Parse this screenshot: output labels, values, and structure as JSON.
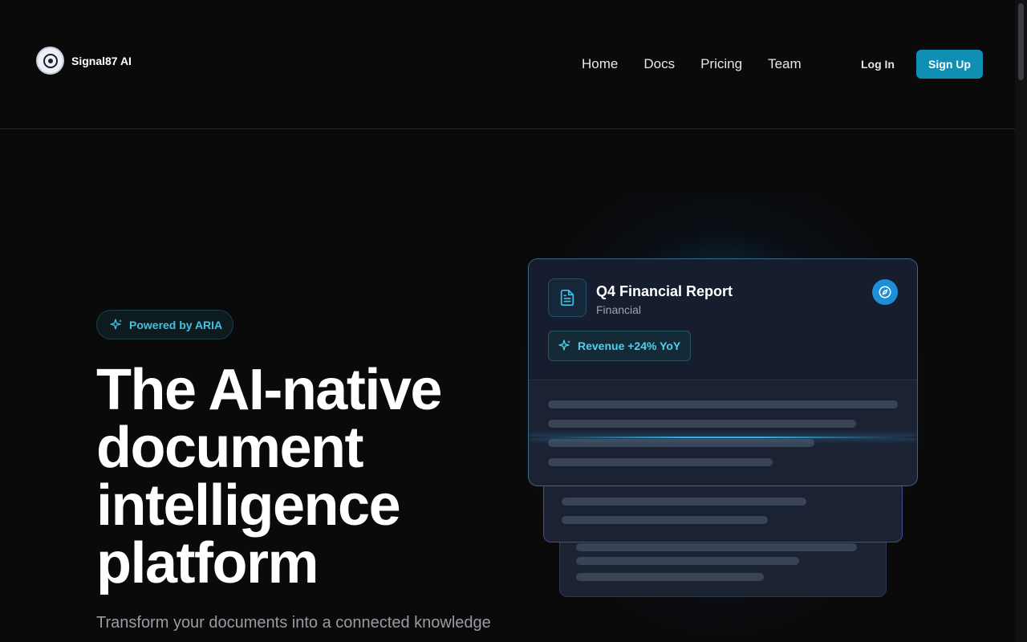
{
  "brand": {
    "name": "Signal87 AI"
  },
  "nav": {
    "links": [
      "Home",
      "Docs",
      "Pricing",
      "Team"
    ],
    "login_label": "Log In",
    "signup_label": "Sign Up"
  },
  "hero": {
    "badge": "Powered by ARIA",
    "headline": "The AI-native document intelligence platform",
    "subtext": "Transform your documents into a connected knowledge"
  },
  "card": {
    "title": "Q4 Financial Report",
    "category": "Financial",
    "metric": "Revenue +24% YoY"
  },
  "colors": {
    "accent": "#0e8fb3",
    "badge_text": "#3fc3e6",
    "background": "#0a0a0b"
  }
}
